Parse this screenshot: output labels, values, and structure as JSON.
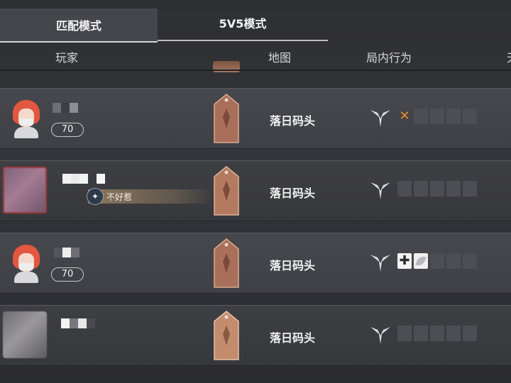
{
  "tabs": [
    {
      "label": "匹配模式",
      "active": true
    },
    {
      "label": "5V5模式",
      "active": false
    }
  ],
  "columns": {
    "player": "玩家",
    "map": "地图",
    "behavior": "局内行为",
    "cut_off": "天"
  },
  "rows": [
    {
      "level": "70",
      "map": "落日码头",
      "badge": "",
      "behavior": [
        "wing-icon",
        "x-icon"
      ]
    },
    {
      "level": "",
      "map": "落日码头",
      "badge": "不好惹",
      "behavior": [
        "wing-icon"
      ]
    },
    {
      "level": "70",
      "map": "落日码头",
      "badge": "",
      "behavior": [
        "wing-icon",
        "plus-icon",
        "leaf-icon"
      ]
    },
    {
      "level": "",
      "map": "落日码头",
      "badge": "",
      "behavior": [
        "wing-icon"
      ]
    }
  ],
  "colors": {
    "accent": "#e2573f",
    "x_orange": "#f08a2a",
    "card_copper": "#b27a5f"
  }
}
